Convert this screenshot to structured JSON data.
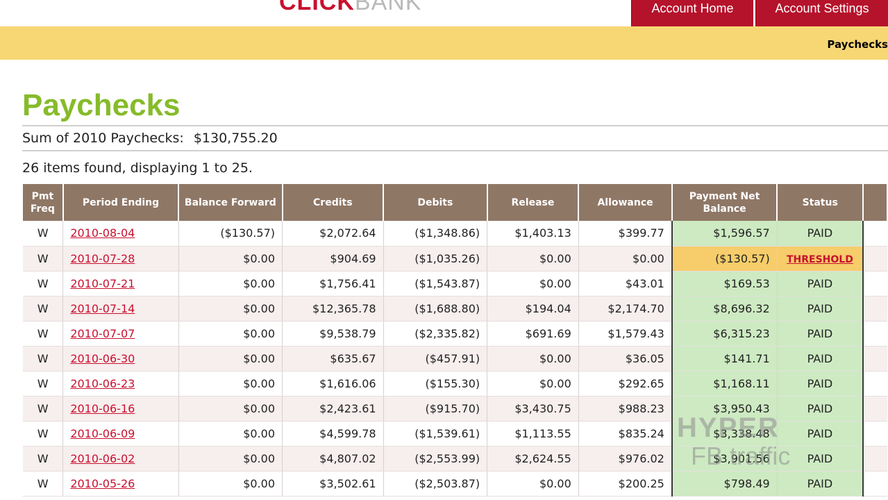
{
  "header": {
    "logo_click": "CLICK",
    "logo_bank": "BANK",
    "tabs": [
      {
        "label": "Account Home"
      },
      {
        "label": "Account Settings"
      }
    ],
    "breadcrumb": "Paychecks"
  },
  "page": {
    "title": "Paychecks",
    "sum_label": "Sum of 2010 Paychecks:",
    "sum_value": "$130,755.20",
    "items_found": "26 items found, displaying 1 to 25."
  },
  "table": {
    "columns": [
      "Pmt Freq",
      "Period Ending",
      "Balance Forward",
      "Credits",
      "Debits",
      "Release",
      "Allowance",
      "Payment Net Balance",
      "Status",
      ""
    ],
    "rows": [
      {
        "freq": "W",
        "period": "2010-08-04",
        "balance": "($130.57)",
        "credits": "$2,072.64",
        "debits": "($1,348.86)",
        "release": "$1,403.13",
        "allowance": "$399.77",
        "net": "$1,596.57",
        "status": "PAID"
      },
      {
        "freq": "W",
        "period": "2010-07-28",
        "balance": "$0.00",
        "credits": "$904.69",
        "debits": "($1,035.26)",
        "release": "$0.00",
        "allowance": "$0.00",
        "net": "($130.57)",
        "status": "THRESHOLD"
      },
      {
        "freq": "W",
        "period": "2010-07-21",
        "balance": "$0.00",
        "credits": "$1,756.41",
        "debits": "($1,543.87)",
        "release": "$0.00",
        "allowance": "$43.01",
        "net": "$169.53",
        "status": "PAID"
      },
      {
        "freq": "W",
        "period": "2010-07-14",
        "balance": "$0.00",
        "credits": "$12,365.78",
        "debits": "($1,688.80)",
        "release": "$194.04",
        "allowance": "$2,174.70",
        "net": "$8,696.32",
        "status": "PAID"
      },
      {
        "freq": "W",
        "period": "2010-07-07",
        "balance": "$0.00",
        "credits": "$9,538.79",
        "debits": "($2,335.82)",
        "release": "$691.69",
        "allowance": "$1,579.43",
        "net": "$6,315.23",
        "status": "PAID"
      },
      {
        "freq": "W",
        "period": "2010-06-30",
        "balance": "$0.00",
        "credits": "$635.67",
        "debits": "($457.91)",
        "release": "$0.00",
        "allowance": "$36.05",
        "net": "$141.71",
        "status": "PAID"
      },
      {
        "freq": "W",
        "period": "2010-06-23",
        "balance": "$0.00",
        "credits": "$1,616.06",
        "debits": "($155.30)",
        "release": "$0.00",
        "allowance": "$292.65",
        "net": "$1,168.11",
        "status": "PAID"
      },
      {
        "freq": "W",
        "period": "2010-06-16",
        "balance": "$0.00",
        "credits": "$2,423.61",
        "debits": "($915.70)",
        "release": "$3,430.75",
        "allowance": "$988.23",
        "net": "$3,950.43",
        "status": "PAID"
      },
      {
        "freq": "W",
        "period": "2010-06-09",
        "balance": "$0.00",
        "credits": "$4,599.78",
        "debits": "($1,539.61)",
        "release": "$1,113.55",
        "allowance": "$835.24",
        "net": "$3,338.48",
        "status": "PAID"
      },
      {
        "freq": "W",
        "period": "2010-06-02",
        "balance": "$0.00",
        "credits": "$4,807.02",
        "debits": "($2,553.99)",
        "release": "$2,624.55",
        "allowance": "$976.02",
        "net": "$3,901.56",
        "status": "PAID"
      },
      {
        "freq": "W",
        "period": "2010-05-26",
        "balance": "$0.00",
        "credits": "$3,502.61",
        "debits": "($2,503.87)",
        "release": "$0.00",
        "allowance": "$200.25",
        "net": "$798.49",
        "status": "PAID"
      }
    ]
  },
  "watermark": {
    "line1": "HYPER",
    "line2": "FB traffic"
  },
  "colors": {
    "brand_red": "#b5132b",
    "title_green": "#86bb2a",
    "header_brown": "#8f7766",
    "paid_green": "#cdeac2",
    "threshold_yellow": "#f6cd6a"
  }
}
